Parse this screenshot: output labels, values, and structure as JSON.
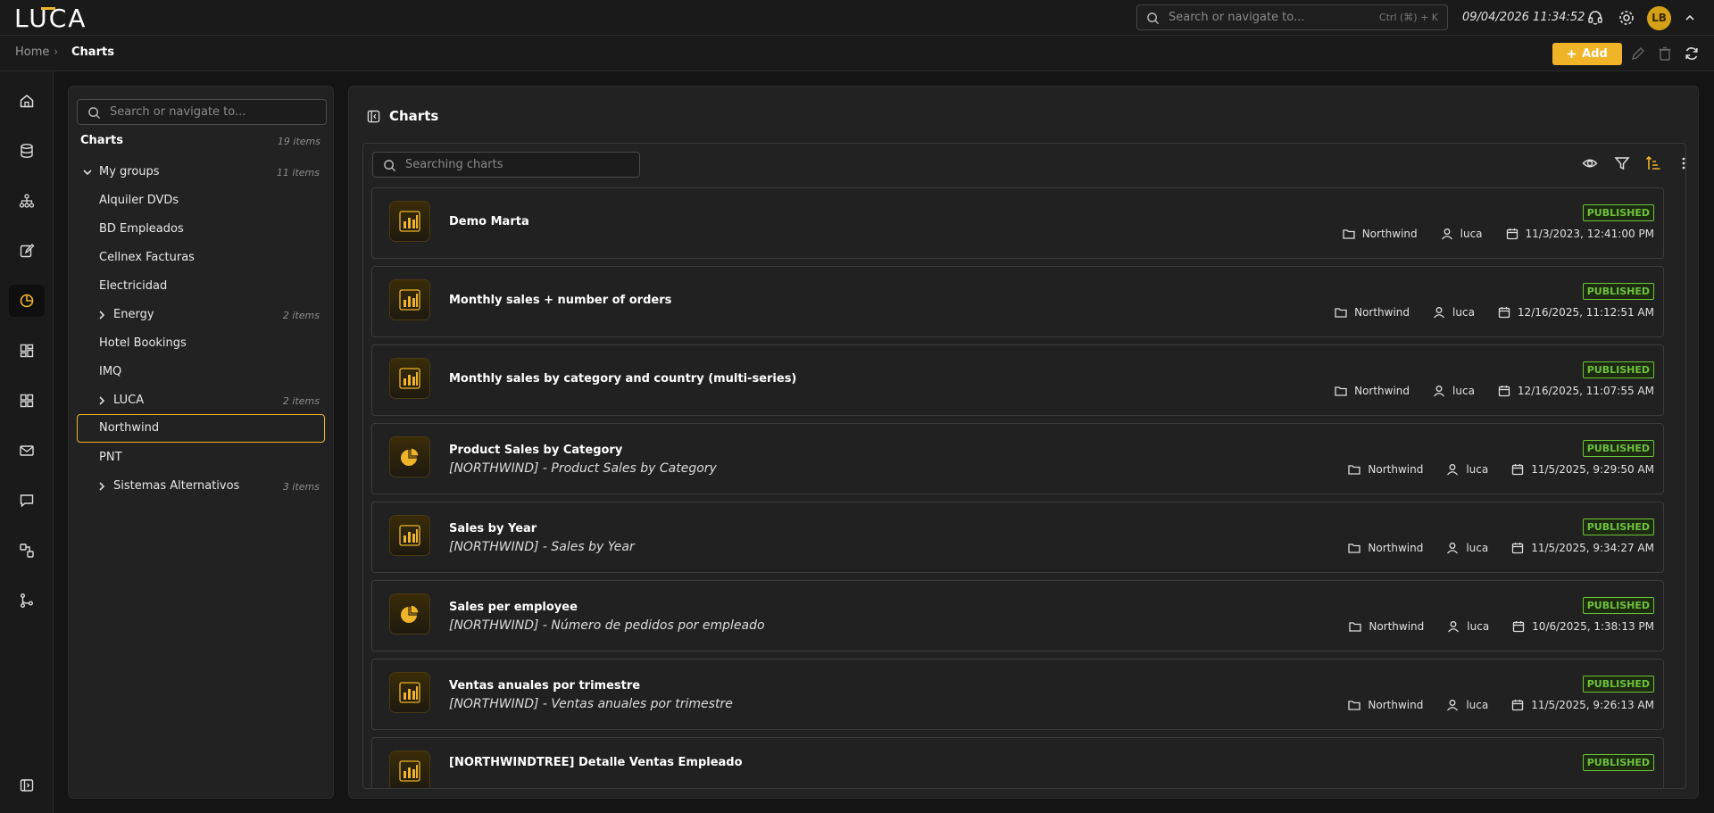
{
  "app": {
    "logo": "LUCA",
    "datetime": "09/04/2026 11:34:52",
    "user_initials": "LB"
  },
  "global_search": {
    "placeholder": "Search or navigate to...",
    "shortcut": "Ctrl (⌘) + K"
  },
  "breadcrumb": {
    "home": "Home",
    "separator": "›",
    "current": "Charts"
  },
  "toolbar": {
    "add_label": "Add"
  },
  "tree": {
    "search_placeholder": "Search or navigate to...",
    "title": "Charts",
    "title_count": "19 items",
    "my_groups": {
      "label": "My groups",
      "count": "11 items"
    },
    "items": [
      {
        "label": "Alquiler DVDs"
      },
      {
        "label": "BD Empleados"
      },
      {
        "label": "Cellnex Facturas"
      },
      {
        "label": "Electricidad"
      },
      {
        "label": "Energy",
        "count": "2 items"
      },
      {
        "label": "Hotel Bookings"
      },
      {
        "label": "IMQ"
      },
      {
        "label": "LUCA",
        "count": "2 items"
      },
      {
        "label": "Northwind"
      },
      {
        "label": "PNT"
      },
      {
        "label": "Sistemas Alternativos",
        "count": "3 items"
      }
    ]
  },
  "main": {
    "title": "Charts",
    "list_search_placeholder": "Searching charts",
    "charts": [
      {
        "title": "Demo Marta",
        "subtitle": "",
        "icon": "bar-chart-icon",
        "status": "PUBLISHED",
        "group": "Northwind",
        "user": "luca",
        "date": "11/3/2023, 12:41:00 PM"
      },
      {
        "title": "Monthly sales + number of orders",
        "subtitle": "",
        "icon": "bar-chart-icon",
        "status": "PUBLISHED",
        "group": "Northwind",
        "user": "luca",
        "date": "12/16/2025, 11:12:51 AM"
      },
      {
        "title": "Monthly sales by category and country (multi-series)",
        "subtitle": "",
        "icon": "bar-chart-icon",
        "status": "PUBLISHED",
        "group": "Northwind",
        "user": "luca",
        "date": "12/16/2025, 11:07:55 AM"
      },
      {
        "title": "Product Sales by Category",
        "subtitle": "[NORTHWIND] - Product Sales by Category",
        "icon": "pie-chart-icon",
        "status": "PUBLISHED",
        "group": "Northwind",
        "user": "luca",
        "date": "11/5/2025, 9:29:50 AM"
      },
      {
        "title": "Sales by Year",
        "subtitle": "[NORTHWIND] - Sales by Year",
        "icon": "bar-chart-icon",
        "status": "PUBLISHED",
        "group": "Northwind",
        "user": "luca",
        "date": "11/5/2025, 9:34:27 AM"
      },
      {
        "title": "Sales per employee",
        "subtitle": "[NORTHWIND] - Número de pedidos por empleado",
        "icon": "pie-chart-icon",
        "status": "PUBLISHED",
        "group": "Northwind",
        "user": "luca",
        "date": "10/6/2025, 1:38:13 PM"
      },
      {
        "title": "Ventas anuales por trimestre",
        "subtitle": "[NORTHWIND] - Ventas anuales por trimestre",
        "icon": "bar-chart-icon",
        "status": "PUBLISHED",
        "group": "Northwind",
        "user": "luca",
        "date": "11/5/2025, 9:26:13 AM"
      },
      {
        "title": "[NORTHWINDTREE] Detalle Ventas Empleado",
        "subtitle": "",
        "icon": "bar-chart-icon",
        "status": "PUBLISHED",
        "group": "",
        "user": "",
        "date": ""
      }
    ]
  },
  "colors": {
    "accent": "#f0b429",
    "published": "#6fc23a",
    "background": "#141414",
    "panel": "#222222"
  }
}
